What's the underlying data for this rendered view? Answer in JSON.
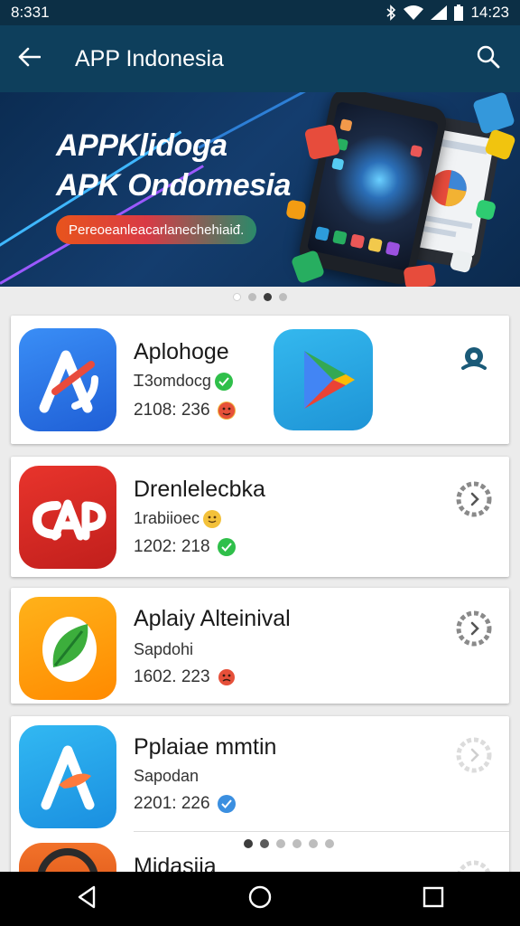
{
  "status_bar": {
    "time": "8:331",
    "clock": "14:23"
  },
  "app_bar": {
    "title": "APP Indonesia"
  },
  "banner": {
    "line1": "APPKlidoga",
    "line2": "APK Ondomesia",
    "pill": "Pereoeanleacarlanechehiaiđ."
  },
  "cards": [
    {
      "name": "Aplohoge",
      "sub": "Ꮖ3omdocg",
      "stat": "2108: 236",
      "icon": "aplohoge-icon",
      "action": "location-pin-icon"
    },
    {
      "name": "Drenlelecbka",
      "sub": "1rabiioec",
      "stat": "1202: 218",
      "icon": "cap-icon",
      "action": "download-progress-icon"
    },
    {
      "name": "Aplaiy Alteinival",
      "sub": "Sapdohi",
      "stat": "1602. 223",
      "icon": "leaf-icon",
      "action": "download-progress-icon"
    },
    {
      "name": "Pplaiae mmtin",
      "sub": "Sapodan",
      "stat": "2201: 226",
      "icon": "letter-a-icon",
      "action": "download-progress-icon"
    },
    {
      "name": "Midasiia",
      "icon": "disc-icon",
      "action": "download-progress-icon"
    }
  ],
  "colors": {
    "status_bar": "#0c2f45",
    "app_bar": "#0e3f5c",
    "banner": "#0b2c52",
    "background": "#ececec"
  }
}
